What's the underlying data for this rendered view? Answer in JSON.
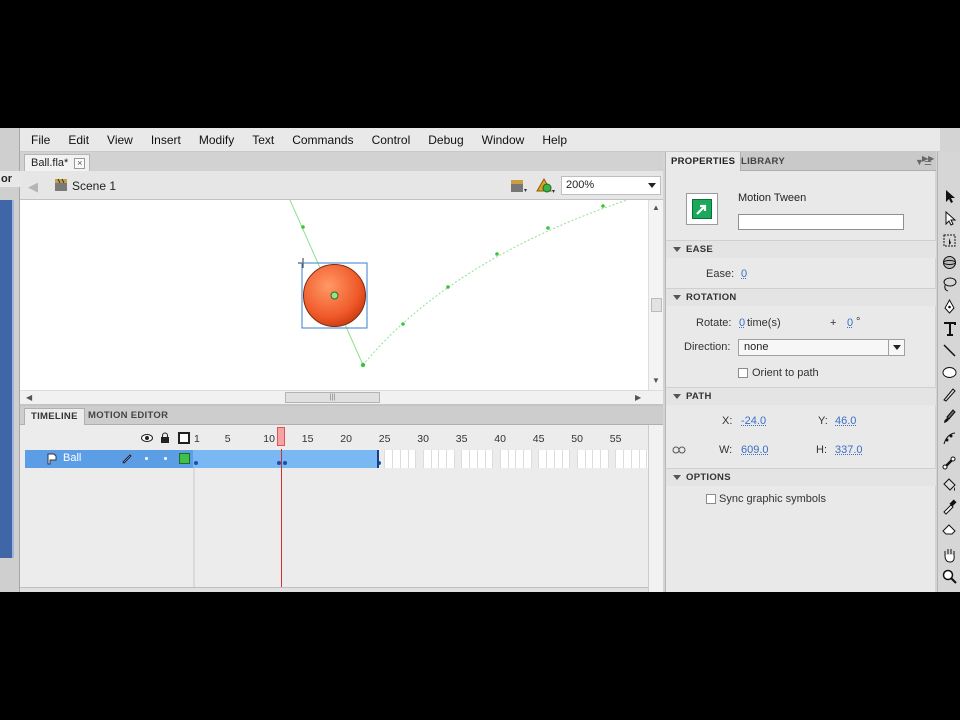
{
  "left_strip": {
    "stub_label": "or"
  },
  "menu": [
    "File",
    "Edit",
    "View",
    "Insert",
    "Modify",
    "Text",
    "Commands",
    "Control",
    "Debug",
    "Window",
    "Help"
  ],
  "document": {
    "tab_title": "Ball.fla*",
    "close_glyph": "×",
    "scene": "Scene 1",
    "zoom": "200%"
  },
  "stage": {
    "scrollbar_grip": "|||"
  },
  "timeline": {
    "tabs": {
      "timeline": "TIMELINE",
      "motion_editor": "MOTION EDITOR"
    },
    "frame_numbers": [
      "1",
      "5",
      "10",
      "15",
      "20",
      "25",
      "30",
      "35",
      "40",
      "45",
      "50",
      "55"
    ],
    "current_frame": 12,
    "tween_end_frame": 25,
    "layer": {
      "name": "Ball",
      "color": "#3ec04a"
    }
  },
  "properties": {
    "tabs": {
      "properties": "PROPERTIES",
      "library": "LIBRARY"
    },
    "instance_type": "Motion Tween",
    "instance_name": "",
    "ease": {
      "section": "EASE",
      "label": "Ease:",
      "value": "0"
    },
    "rotation": {
      "section": "ROTATION",
      "rotate_label": "Rotate:",
      "rotate_times": "0",
      "times_unit": "time(s)",
      "plus": "+",
      "rotate_degrees": "0",
      "degree_unit": "°",
      "direction_label": "Direction:",
      "direction_value": "none",
      "orient_label": "Orient to path"
    },
    "path": {
      "section": "PATH",
      "x_label": "X:",
      "x": "-24.0",
      "y_label": "Y:",
      "y": "46.0",
      "w_label": "W:",
      "w": "609.0",
      "h_label": "H:",
      "h": "337.0"
    },
    "options": {
      "section": "OPTIONS",
      "sync_label": "Sync graphic symbols"
    }
  },
  "colors": {
    "accent_blue": "#5c9ee6",
    "ball_fill": "#f06a3a",
    "path_green": "#7fdc7f"
  }
}
